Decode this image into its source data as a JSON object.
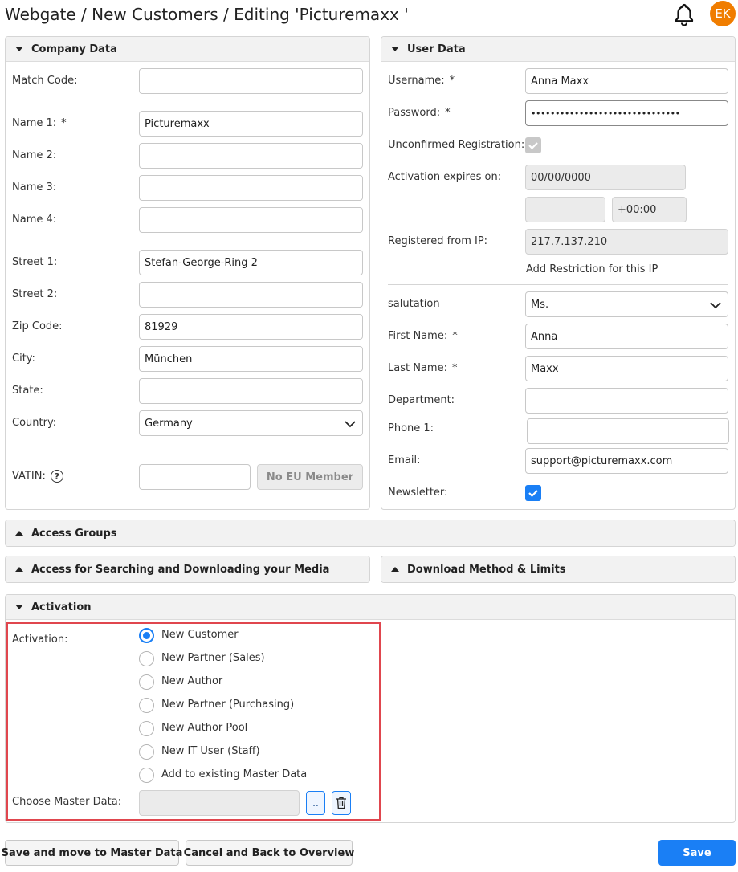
{
  "header": {
    "title": "Webgate / New Customers / Editing 'Picturemaxx '",
    "user_initials": "EK",
    "avatar_color": "#f07d00"
  },
  "company": {
    "title": "Company Data",
    "match_code": {
      "label": "Match Code:",
      "value": ""
    },
    "name1": {
      "label": "Name 1:",
      "value": "Picturemaxx"
    },
    "name2": {
      "label": "Name 2:",
      "value": ""
    },
    "name3": {
      "label": "Name 3:",
      "value": ""
    },
    "name4": {
      "label": "Name 4:",
      "value": ""
    },
    "street1": {
      "label": "Street 1:",
      "value": "Stefan-George-Ring 2"
    },
    "street2": {
      "label": "Street 2:",
      "value": ""
    },
    "zip": {
      "label": "Zip Code:",
      "value": "81929"
    },
    "city": {
      "label": "City:",
      "value": "München"
    },
    "state": {
      "label": "State:",
      "value": ""
    },
    "country": {
      "label": "Country:",
      "value": "Germany"
    },
    "vatin": {
      "label": "VATIN:",
      "value": "",
      "button": "No EU Member"
    }
  },
  "user": {
    "title": "User Data",
    "username": {
      "label": "Username:",
      "value": "Anna Maxx"
    },
    "password": {
      "label": "Password:",
      "value": "•••••••••••••••••••••••••••••••"
    },
    "unconfirmed": {
      "label": "Unconfirmed Registration:",
      "checked": true
    },
    "activation_expires": {
      "label": "Activation expires on:",
      "date": "00/00/0000",
      "time": "",
      "tz": "+00:00"
    },
    "registered_ip": {
      "label": "Registered from IP:",
      "value": "217.7.137.210",
      "link": "Add Restriction for this IP"
    },
    "salutation": {
      "label": "salutation",
      "value": "Ms."
    },
    "first_name": {
      "label": "First Name:",
      "value": "Anna"
    },
    "last_name": {
      "label": "Last Name:",
      "value": "Maxx"
    },
    "department": {
      "label": "Department:",
      "value": ""
    },
    "phone1": {
      "label": "Phone 1:",
      "value": ""
    },
    "email": {
      "label": "Email:",
      "value": "support@picturemaxx.com"
    },
    "newsletter": {
      "label": "Newsletter:",
      "checked": true
    }
  },
  "required_mark": "*",
  "sections": {
    "access_groups": "Access Groups",
    "access_search": "Access for Searching and Downloading your Media",
    "download_method": "Download Method & Limits",
    "activation": "Activation"
  },
  "activation": {
    "label": "Activation:",
    "options": [
      {
        "label": "New Customer",
        "selected": true
      },
      {
        "label": "New Partner (Sales)",
        "selected": false
      },
      {
        "label": "New Author",
        "selected": false
      },
      {
        "label": "New Partner (Purchasing)",
        "selected": false
      },
      {
        "label": "New Author Pool",
        "selected": false
      },
      {
        "label": "New IT User (Staff)",
        "selected": false
      },
      {
        "label": "Add to existing Master Data",
        "selected": false
      }
    ],
    "master_data": {
      "label": "Choose Master Data:",
      "value": "",
      "browse_label": ".."
    }
  },
  "footer": {
    "save_master": "Save and move to Master Data",
    "cancel": "Cancel and Back to Overview",
    "save": "Save"
  },
  "colors": {
    "accent": "#1a7ff5",
    "highlight_border": "#e0464e"
  }
}
